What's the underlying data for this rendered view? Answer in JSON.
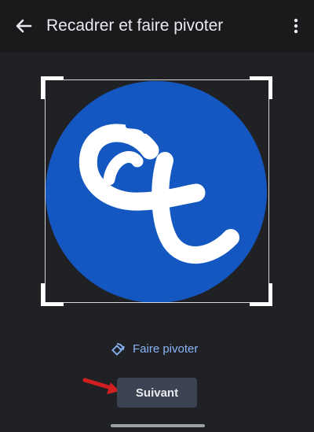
{
  "app_bar": {
    "title": "Recadrer et faire pivoter",
    "back_icon": "arrow-back-icon",
    "more_icon": "more-vert-icon"
  },
  "image": {
    "logo_letters": "et",
    "background_color": "#1557c0",
    "letter_color": "#ffffff"
  },
  "actions": {
    "rotate_label": "Faire pivoter",
    "rotate_icon": "rotate-icon",
    "next_label": "Suivant"
  },
  "colors": {
    "accent": "#8ab4f8",
    "annotation_arrow": "#d11f1f",
    "button_bg": "#3c4453",
    "background": "#202124"
  }
}
